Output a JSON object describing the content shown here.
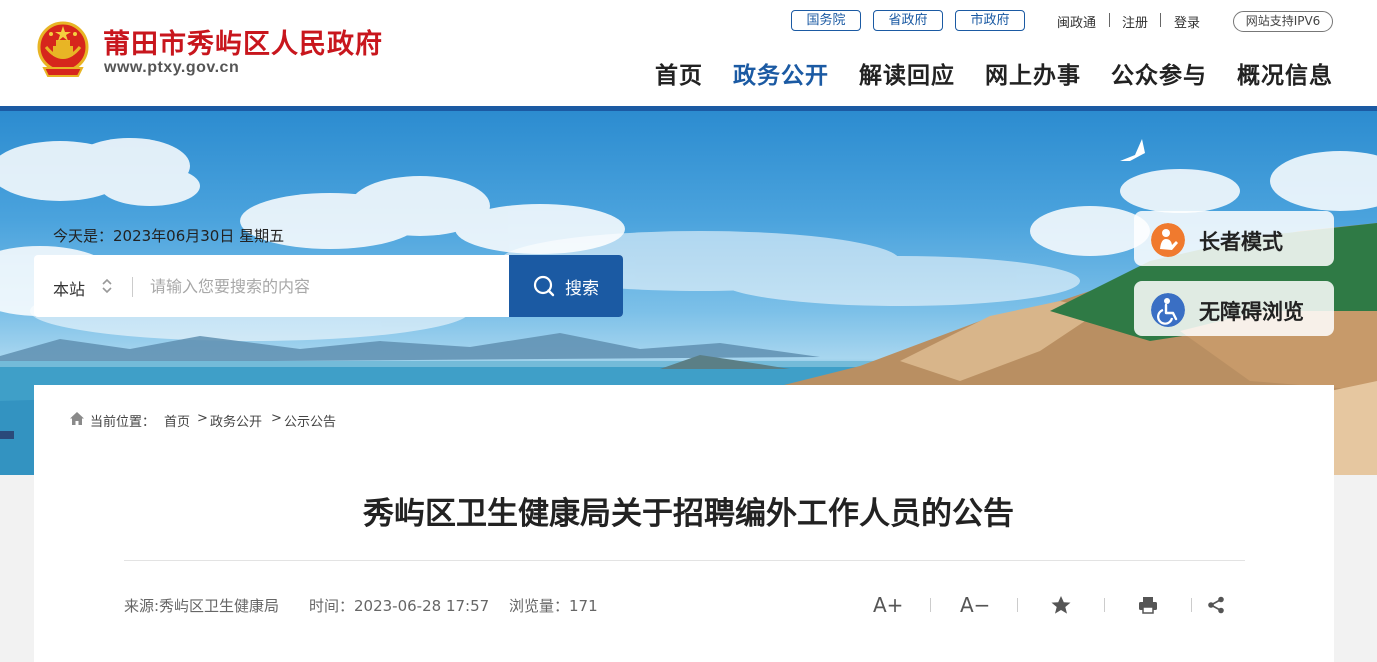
{
  "header": {
    "site_title": "莆田市秀屿区人民政府",
    "site_url": "www.ptxy.gov.cn",
    "gov_links": [
      "国务院",
      "省政府",
      "市政府"
    ],
    "top_links": [
      "闽政通",
      "注册",
      "登录"
    ],
    "ipv6": "网站支持IPV6",
    "nav": [
      "首页",
      "政务公开",
      "解读回应",
      "网上办事",
      "公众参与",
      "概况信息"
    ],
    "active_nav": "政务公开"
  },
  "banner": {
    "today": "今天是：2023年06月30日 星期五",
    "search": {
      "scope": "本站",
      "placeholder": "请输入您要搜索的内容",
      "button": "搜索"
    },
    "modes": {
      "elder": "长者模式",
      "accessible": "无障碍浏览"
    }
  },
  "breadcrumb": {
    "label": "当前位置：",
    "items": [
      "首页",
      "政务公开",
      "公示公告"
    ],
    "sep": ">"
  },
  "article": {
    "title": "秀屿区卫生健康局关于招聘编外工作人员的公告",
    "source": "来源:秀屿区卫生健康局",
    "time": "时间：2023-06-28 17:57",
    "views": "浏览量：171",
    "tools": {
      "font_up": "A+",
      "font_down": "A−"
    }
  },
  "colors": {
    "brand_blue": "#1b5aa3",
    "title_red": "#c8161d",
    "elder_orange": "#f07a2e",
    "accessible_blue": "#3a6fc4"
  },
  "icons": [
    "emblem-icon",
    "chevron-updown-icon",
    "search-icon",
    "elder-icon",
    "wheelchair-icon",
    "home-icon",
    "star-icon",
    "print-icon",
    "share-icon"
  ]
}
